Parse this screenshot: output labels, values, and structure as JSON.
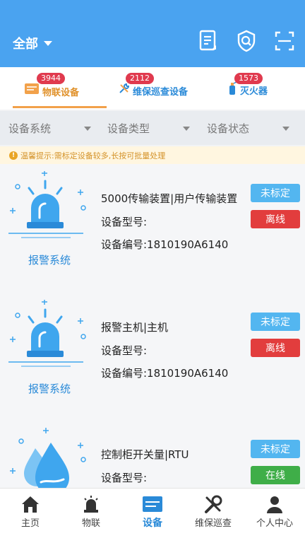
{
  "header": {
    "scope_label": "全部",
    "icons": [
      "document-icon",
      "shield-search-icon",
      "scan-icon"
    ]
  },
  "tabs": [
    {
      "label": "物联设备",
      "badge": "3944",
      "icon": "device-list-icon",
      "active": true
    },
    {
      "label": "维保巡查设备",
      "badge": "2112",
      "icon": "wrench-icon",
      "active": false
    },
    {
      "label": "灭火器",
      "badge": "1573",
      "icon": "extinguisher-icon",
      "active": false
    }
  ],
  "filters": [
    "设备系统",
    "设备类型",
    "设备状态"
  ],
  "notice": "温馨提示:需标定设备较多,长按可批量处理",
  "devices": [
    {
      "system": "报警系统",
      "name": "5000传输装置|用户传输装置",
      "model": "设备型号:",
      "serial": "设备编号:1810190A6140",
      "calibration": "未标定",
      "status": "离线",
      "status_color": "#e23d3d"
    },
    {
      "system": "报警系统",
      "name": "报警主机|主机",
      "model": "设备型号:",
      "serial": "设备编号:1810190A6140",
      "calibration": "未标定",
      "status": "离线",
      "status_color": "#e23d3d"
    },
    {
      "system": "",
      "name": "控制柜开关量|RTU",
      "model": "设备型号:",
      "serial": "",
      "calibration": "未标定",
      "status": "在线",
      "status_color": "#3fae48"
    }
  ],
  "nav": [
    {
      "label": "主页",
      "icon": "home-icon",
      "active": false
    },
    {
      "label": "物联",
      "icon": "alarm-icon",
      "active": false
    },
    {
      "label": "设备",
      "icon": "device-card-icon",
      "active": true
    },
    {
      "label": "维保巡查",
      "icon": "tools-icon",
      "active": false
    },
    {
      "label": "个人中心",
      "icon": "user-icon",
      "active": false
    }
  ],
  "colors": {
    "primary": "#4aa3f0",
    "accent_orange": "#f2a14a",
    "offline": "#e23d3d",
    "online": "#3fae48",
    "calibration": "#53b6f0"
  }
}
